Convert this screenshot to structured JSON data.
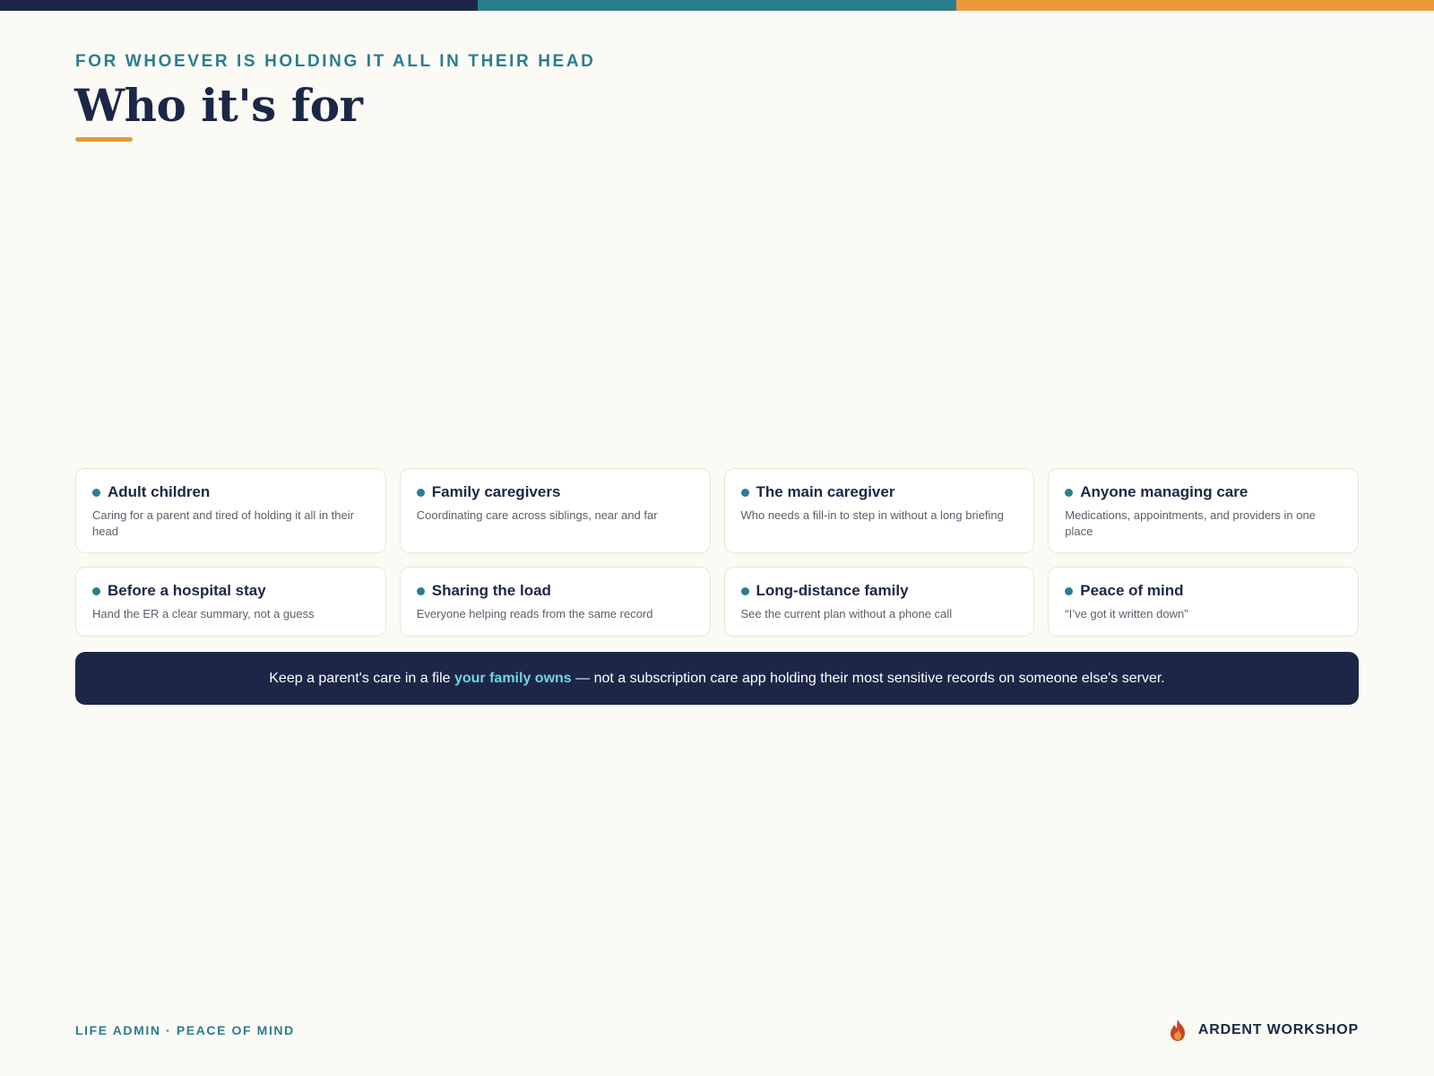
{
  "colors": {
    "navy": "#1c2747",
    "teal": "#2c7d8e",
    "orange": "#e99a3b",
    "highlight_cyan": "#72d3e4",
    "background": "#fbfaf5"
  },
  "header": {
    "eyebrow": "FOR WHOEVER IS HOLDING IT ALL IN THEIR HEAD",
    "title": "Who it's for"
  },
  "cards": [
    {
      "title": "Adult children",
      "desc": "Caring for a parent and tired of holding it all in their head"
    },
    {
      "title": "Family caregivers",
      "desc": "Coordinating care across siblings, near and far"
    },
    {
      "title": "The main caregiver",
      "desc": "Who needs a fill-in to step in without a long briefing"
    },
    {
      "title": "Anyone managing care",
      "desc": "Medications, appointments, and providers in one place"
    },
    {
      "title": "Before a hospital stay",
      "desc": "Hand the ER a clear summary, not a guess"
    },
    {
      "title": "Sharing the load",
      "desc": "Everyone helping reads from the same record"
    },
    {
      "title": "Long-distance family",
      "desc": "See the current plan without a phone call"
    },
    {
      "title": "Peace of mind",
      "desc": "“I’ve got it written down”"
    }
  ],
  "banner": {
    "before": "Keep a parent's care in a file ",
    "highlight": "your family owns",
    "after": " — not a subscription care app holding their most sensitive records on someone else's server."
  },
  "footer": {
    "left": "LIFE ADMIN · PEACE OF MIND",
    "brand": "ARDENT WORKSHOP",
    "brand_icon": "flame-logo-icon"
  }
}
